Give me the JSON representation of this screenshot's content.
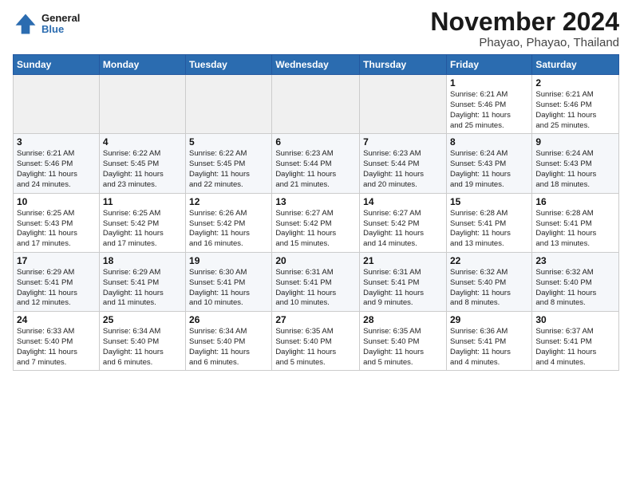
{
  "logo": {
    "line1": "General",
    "line2": "Blue"
  },
  "title": "November 2024",
  "subtitle": "Phayao, Phayao, Thailand",
  "weekdays": [
    "Sunday",
    "Monday",
    "Tuesday",
    "Wednesday",
    "Thursday",
    "Friday",
    "Saturday"
  ],
  "weeks": [
    [
      {
        "day": "",
        "info": ""
      },
      {
        "day": "",
        "info": ""
      },
      {
        "day": "",
        "info": ""
      },
      {
        "day": "",
        "info": ""
      },
      {
        "day": "",
        "info": ""
      },
      {
        "day": "1",
        "info": "Sunrise: 6:21 AM\nSunset: 5:46 PM\nDaylight: 11 hours\nand 25 minutes."
      },
      {
        "day": "2",
        "info": "Sunrise: 6:21 AM\nSunset: 5:46 PM\nDaylight: 11 hours\nand 25 minutes."
      }
    ],
    [
      {
        "day": "3",
        "info": "Sunrise: 6:21 AM\nSunset: 5:46 PM\nDaylight: 11 hours\nand 24 minutes."
      },
      {
        "day": "4",
        "info": "Sunrise: 6:22 AM\nSunset: 5:45 PM\nDaylight: 11 hours\nand 23 minutes."
      },
      {
        "day": "5",
        "info": "Sunrise: 6:22 AM\nSunset: 5:45 PM\nDaylight: 11 hours\nand 22 minutes."
      },
      {
        "day": "6",
        "info": "Sunrise: 6:23 AM\nSunset: 5:44 PM\nDaylight: 11 hours\nand 21 minutes."
      },
      {
        "day": "7",
        "info": "Sunrise: 6:23 AM\nSunset: 5:44 PM\nDaylight: 11 hours\nand 20 minutes."
      },
      {
        "day": "8",
        "info": "Sunrise: 6:24 AM\nSunset: 5:43 PM\nDaylight: 11 hours\nand 19 minutes."
      },
      {
        "day": "9",
        "info": "Sunrise: 6:24 AM\nSunset: 5:43 PM\nDaylight: 11 hours\nand 18 minutes."
      }
    ],
    [
      {
        "day": "10",
        "info": "Sunrise: 6:25 AM\nSunset: 5:43 PM\nDaylight: 11 hours\nand 17 minutes."
      },
      {
        "day": "11",
        "info": "Sunrise: 6:25 AM\nSunset: 5:42 PM\nDaylight: 11 hours\nand 17 minutes."
      },
      {
        "day": "12",
        "info": "Sunrise: 6:26 AM\nSunset: 5:42 PM\nDaylight: 11 hours\nand 16 minutes."
      },
      {
        "day": "13",
        "info": "Sunrise: 6:27 AM\nSunset: 5:42 PM\nDaylight: 11 hours\nand 15 minutes."
      },
      {
        "day": "14",
        "info": "Sunrise: 6:27 AM\nSunset: 5:42 PM\nDaylight: 11 hours\nand 14 minutes."
      },
      {
        "day": "15",
        "info": "Sunrise: 6:28 AM\nSunset: 5:41 PM\nDaylight: 11 hours\nand 13 minutes."
      },
      {
        "day": "16",
        "info": "Sunrise: 6:28 AM\nSunset: 5:41 PM\nDaylight: 11 hours\nand 13 minutes."
      }
    ],
    [
      {
        "day": "17",
        "info": "Sunrise: 6:29 AM\nSunset: 5:41 PM\nDaylight: 11 hours\nand 12 minutes."
      },
      {
        "day": "18",
        "info": "Sunrise: 6:29 AM\nSunset: 5:41 PM\nDaylight: 11 hours\nand 11 minutes."
      },
      {
        "day": "19",
        "info": "Sunrise: 6:30 AM\nSunset: 5:41 PM\nDaylight: 11 hours\nand 10 minutes."
      },
      {
        "day": "20",
        "info": "Sunrise: 6:31 AM\nSunset: 5:41 PM\nDaylight: 11 hours\nand 10 minutes."
      },
      {
        "day": "21",
        "info": "Sunrise: 6:31 AM\nSunset: 5:41 PM\nDaylight: 11 hours\nand 9 minutes."
      },
      {
        "day": "22",
        "info": "Sunrise: 6:32 AM\nSunset: 5:40 PM\nDaylight: 11 hours\nand 8 minutes."
      },
      {
        "day": "23",
        "info": "Sunrise: 6:32 AM\nSunset: 5:40 PM\nDaylight: 11 hours\nand 8 minutes."
      }
    ],
    [
      {
        "day": "24",
        "info": "Sunrise: 6:33 AM\nSunset: 5:40 PM\nDaylight: 11 hours\nand 7 minutes."
      },
      {
        "day": "25",
        "info": "Sunrise: 6:34 AM\nSunset: 5:40 PM\nDaylight: 11 hours\nand 6 minutes."
      },
      {
        "day": "26",
        "info": "Sunrise: 6:34 AM\nSunset: 5:40 PM\nDaylight: 11 hours\nand 6 minutes."
      },
      {
        "day": "27",
        "info": "Sunrise: 6:35 AM\nSunset: 5:40 PM\nDaylight: 11 hours\nand 5 minutes."
      },
      {
        "day": "28",
        "info": "Sunrise: 6:35 AM\nSunset: 5:40 PM\nDaylight: 11 hours\nand 5 minutes."
      },
      {
        "day": "29",
        "info": "Sunrise: 6:36 AM\nSunset: 5:41 PM\nDaylight: 11 hours\nand 4 minutes."
      },
      {
        "day": "30",
        "info": "Sunrise: 6:37 AM\nSunset: 5:41 PM\nDaylight: 11 hours\nand 4 minutes."
      }
    ]
  ]
}
